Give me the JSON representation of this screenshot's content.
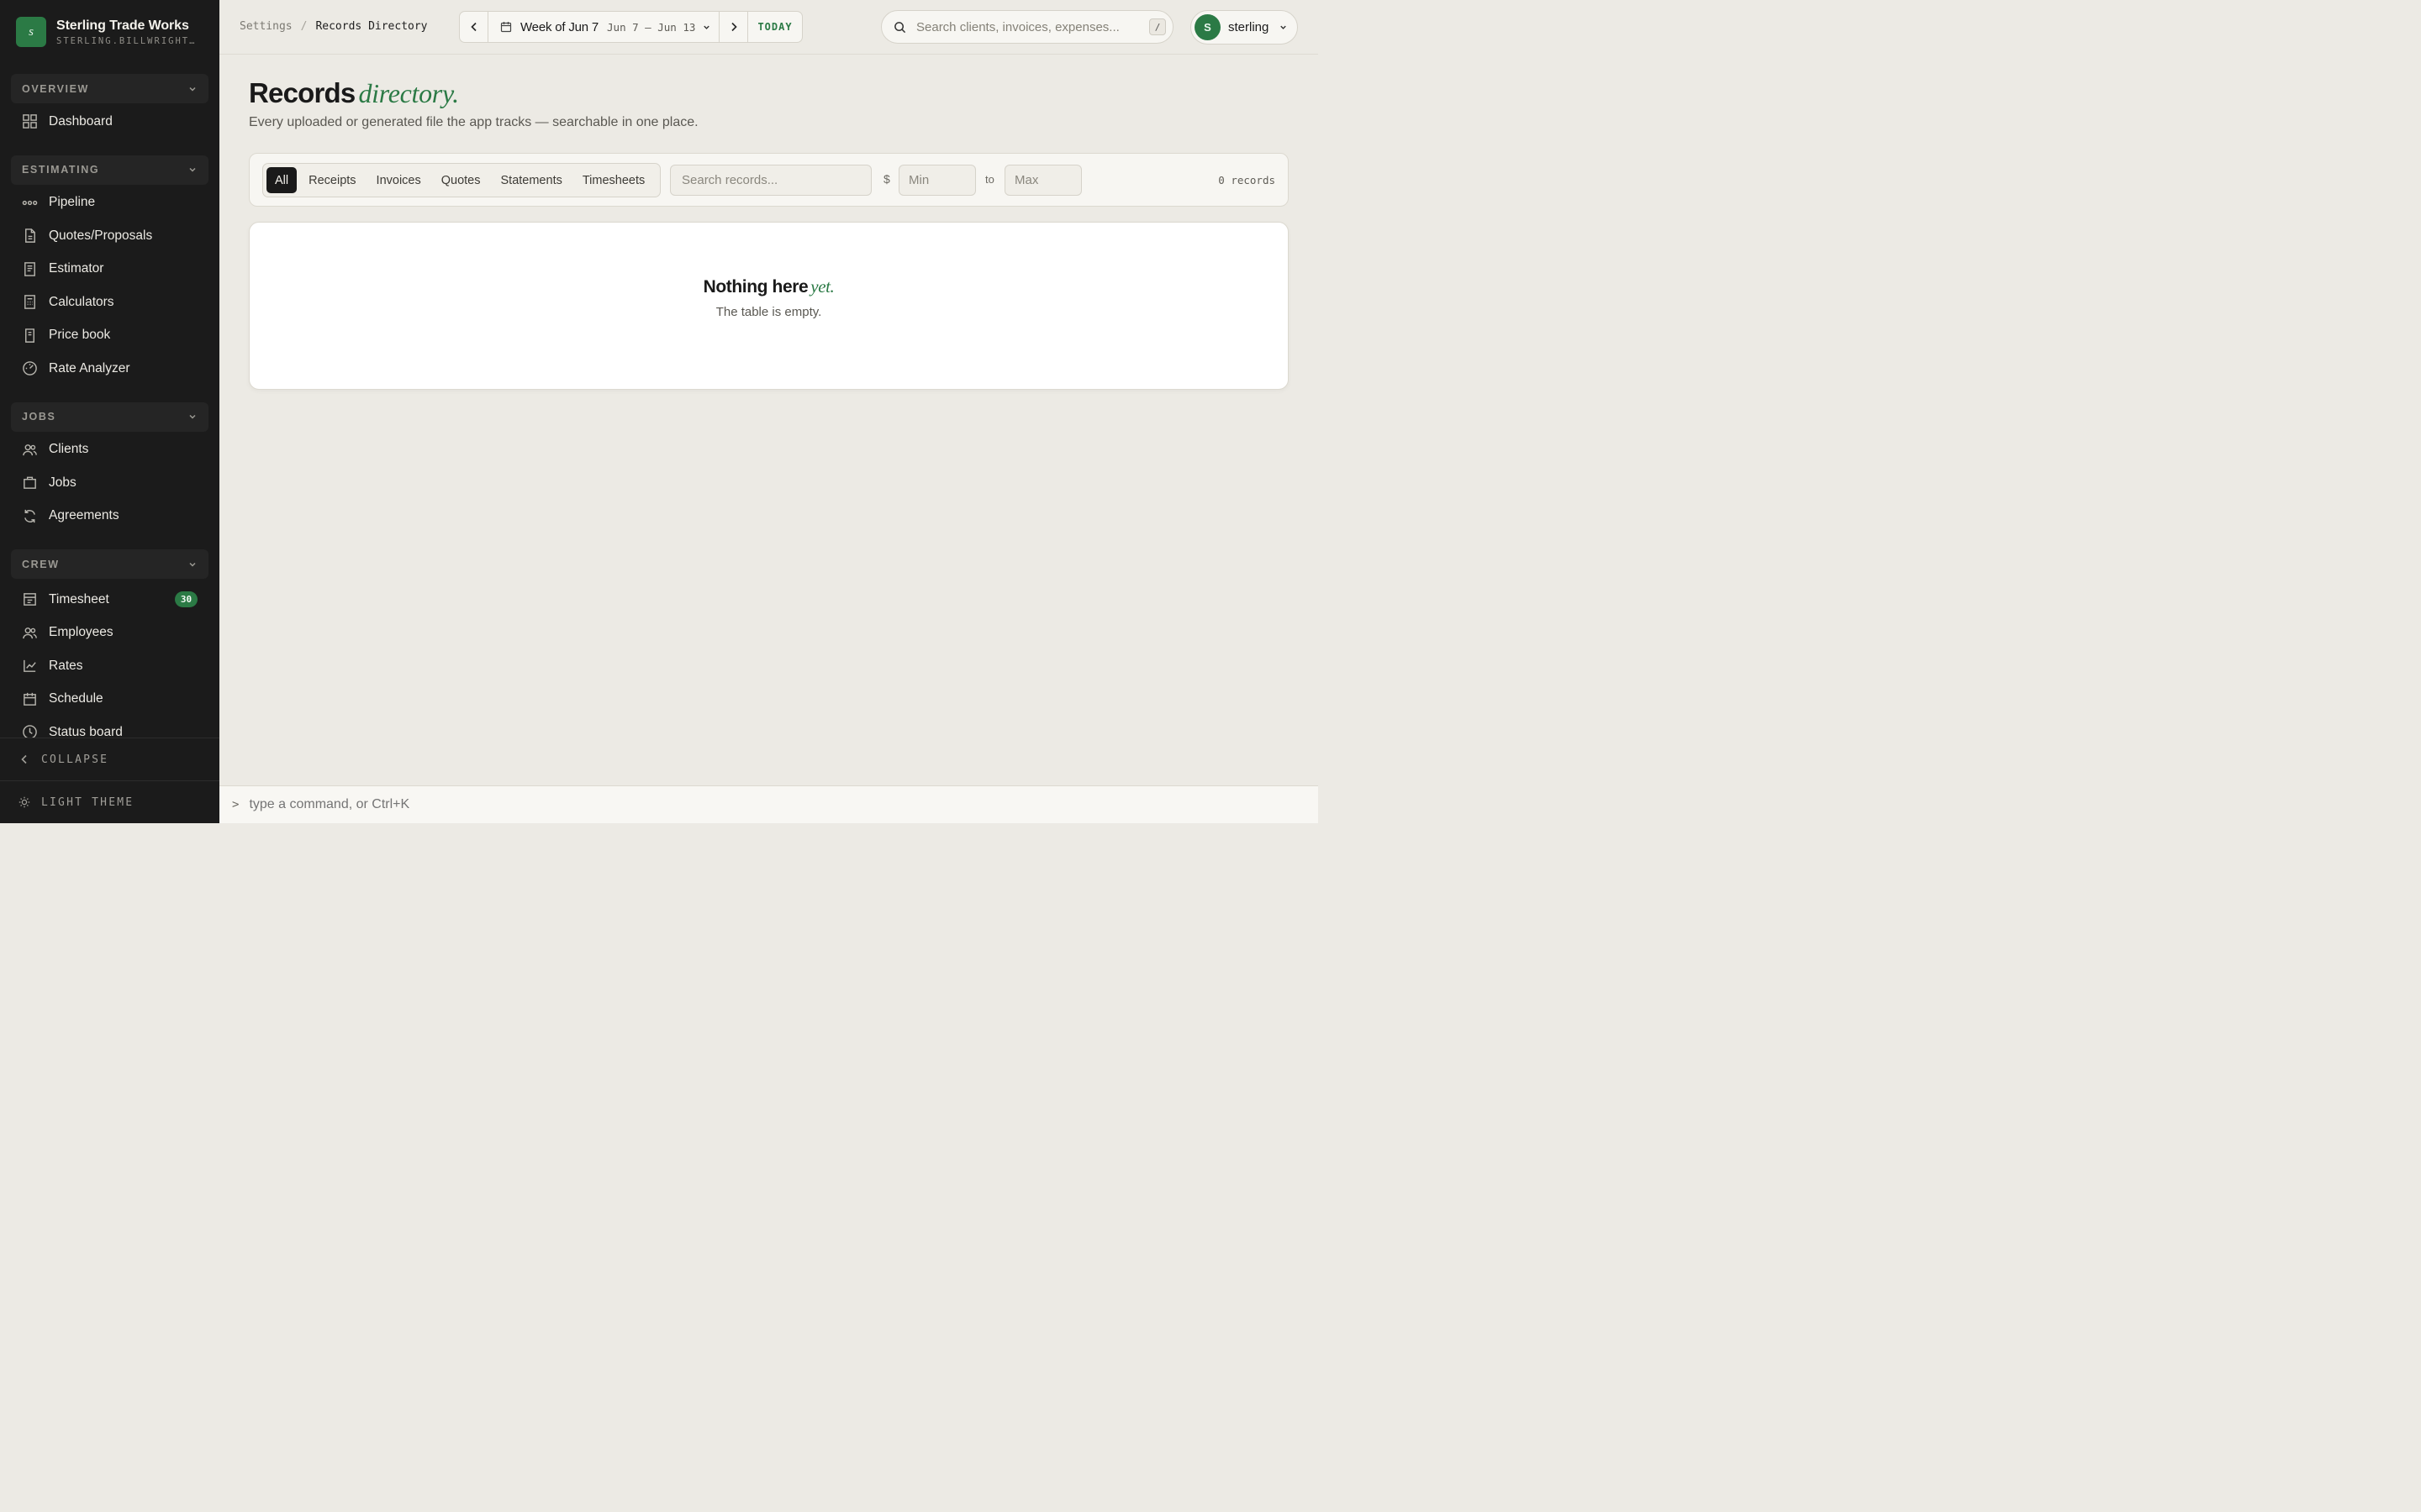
{
  "brand": {
    "logo_letter": "s",
    "name": "Sterling Trade Works",
    "subdomain": "STERLING.BILLWRIGHT.APP"
  },
  "sidebar": {
    "sections": [
      {
        "label": "OVERVIEW",
        "items": [
          {
            "label": "Dashboard",
            "icon": "grid-icon"
          }
        ]
      },
      {
        "label": "ESTIMATING",
        "items": [
          {
            "label": "Pipeline",
            "icon": "pipeline-icon"
          },
          {
            "label": "Quotes/Proposals",
            "icon": "document-icon"
          },
          {
            "label": "Estimator",
            "icon": "receipt-icon"
          },
          {
            "label": "Calculators",
            "icon": "calculator-icon"
          },
          {
            "label": "Price book",
            "icon": "book-icon"
          },
          {
            "label": "Rate Analyzer",
            "icon": "gauge-icon"
          }
        ]
      },
      {
        "label": "JOBS",
        "items": [
          {
            "label": "Clients",
            "icon": "users-icon"
          },
          {
            "label": "Jobs",
            "icon": "briefcase-icon"
          },
          {
            "label": "Agreements",
            "icon": "refresh-icon"
          }
        ]
      },
      {
        "label": "CREW",
        "items": [
          {
            "label": "Timesheet",
            "icon": "timesheet-icon",
            "badge": "30"
          },
          {
            "label": "Employees",
            "icon": "users-icon"
          },
          {
            "label": "Rates",
            "icon": "chart-line-icon"
          },
          {
            "label": "Schedule",
            "icon": "calendar-icon"
          },
          {
            "label": "Status board",
            "icon": "clock-icon"
          }
        ]
      }
    ],
    "collapse_label": "COLLAPSE",
    "theme_label": "LIGHT THEME"
  },
  "topbar": {
    "breadcrumb": {
      "parent": "Settings",
      "separator": "/",
      "current": "Records Directory"
    },
    "week": {
      "label": "Week of Jun 7",
      "range": "Jun 7 – Jun 13",
      "today_label": "TODAY"
    },
    "search": {
      "placeholder": "Search clients, invoices, expenses...",
      "shortcut": "/"
    },
    "user": {
      "initial": "S",
      "name": "sterling"
    }
  },
  "main": {
    "title": "Records",
    "title_accent": "directory.",
    "subtitle": "Every uploaded or generated file the app tracks — searchable in one place.",
    "filters": {
      "tabs": [
        "All",
        "Receipts",
        "Invoices",
        "Quotes",
        "Statements",
        "Timesheets"
      ],
      "active_tab": "All",
      "search_placeholder": "Search records...",
      "currency": "$",
      "min_placeholder": "Min",
      "to_label": "to",
      "max_placeholder": "Max",
      "count": "0 records"
    },
    "empty": {
      "title": "Nothing here",
      "title_accent": "yet.",
      "message": "The table is empty."
    }
  },
  "command_bar": {
    "prompt": ">",
    "placeholder": "type a command, or Ctrl+K"
  },
  "colors": {
    "accent": "#2b7a45",
    "sidebar_bg": "#1b1b1b",
    "page_bg": "#eceae4"
  }
}
